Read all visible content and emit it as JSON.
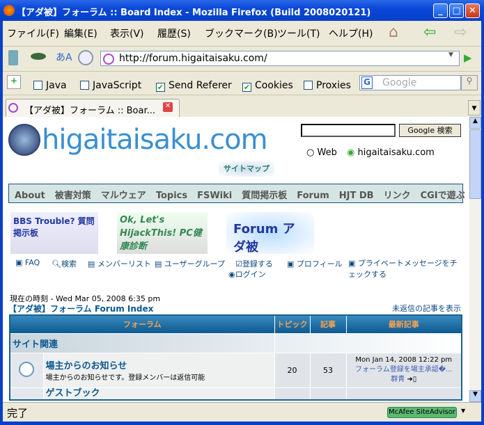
{
  "window": {
    "title": "【アダ被】フォーラム :: Board Index - Mozilla Firefox (Build 2008020121)"
  },
  "menu": [
    "ファイル(F)",
    "編集(E)",
    "表示(V)",
    "履歴(S)",
    "ブックマーク(B)",
    "ツール(T)",
    "ヘルプ(H)"
  ],
  "url": "http://forum.higaitaisaku.com/",
  "toggles": [
    {
      "label": "Java",
      "checked": false
    },
    {
      "label": "JavaScript",
      "checked": false
    },
    {
      "label": "Send Referer",
      "checked": true
    },
    {
      "label": "Cookies",
      "checked": true
    },
    {
      "label": "Proxies",
      "checked": false
    }
  ],
  "google_placeholder": "Google",
  "tab": {
    "title": "【アダ被】フォーラム :: Boar..."
  },
  "site": {
    "logo": "higaitaisaku.com",
    "search_button": "Google 検索",
    "radio_web": "Web",
    "radio_site": "higaitaisaku.com",
    "sitemap": "サイトマップ",
    "nav": [
      "About",
      "被害対策",
      "マルウェア",
      "Topics",
      "FSWiki",
      "質問掲示板",
      "Forum",
      "HJT DB",
      "リンク",
      "CGIで遊ぶ"
    ],
    "banners": [
      "BBS Trouble? 質問掲示板",
      "Ok, Let's HijackThis! PC健康診断",
      "Forum アダ被"
    ]
  },
  "forum_links": [
    "FAQ",
    "検索",
    "メンバーリスト",
    "ユーザーグループ",
    "登録する",
    "プロフィール",
    "プライベートメッセージをチェックする",
    "ログイン"
  ],
  "current_time": "現在の時刻 - Wed Mar 05, 2008 6:35 pm",
  "index_title": "【アダ被】フォーラム Forum Index",
  "unanswered": "未返信の記事を表示",
  "table": {
    "headers": [
      "フォーラム",
      "トピック",
      "記事",
      "最新記事"
    ],
    "category": "サイト関連",
    "rows": [
      {
        "name": "場主からのお知らせ",
        "desc": "場主からのお知らせです。登録メンバーは返信可能",
        "topics": "20",
        "posts": "53",
        "last_date": "Mon Jan 14, 2008 12:22 pm",
        "last_title": "フォーラム登録を場主承認�...",
        "last_user": "群青"
      },
      {
        "name": "ゲストブック",
        "desc": "",
        "topics": "",
        "posts": "",
        "last_date": "",
        "last_title": "",
        "last_user": ""
      }
    ]
  },
  "status": {
    "text": "完了",
    "addon": "McAfee SiteAdvisor"
  }
}
